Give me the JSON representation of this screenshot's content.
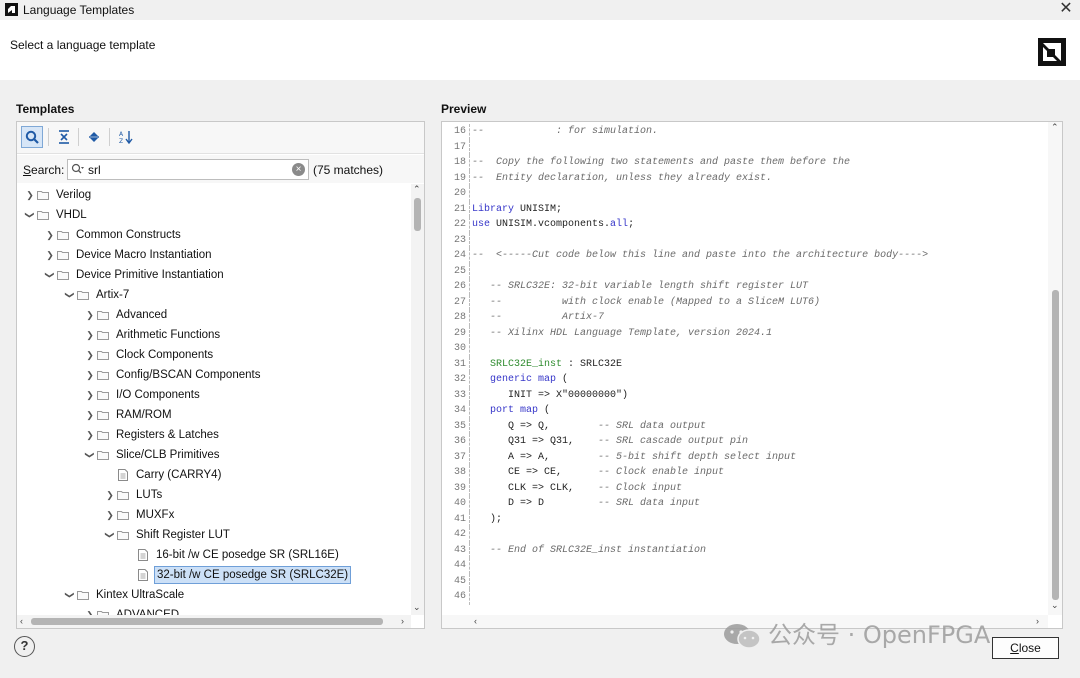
{
  "window": {
    "title": "Language Templates",
    "close_glyph": "✕"
  },
  "header": {
    "subtitle": "Select a language template"
  },
  "templates": {
    "label": "Templates",
    "search": {
      "label_mnemonic": "S",
      "label_rest": "earch:",
      "value": "srl",
      "placeholder": "",
      "matches": "(75 matches)"
    },
    "tree": [
      {
        "label": "Verilog",
        "depth": 0,
        "state": "collapsed",
        "type": "folder"
      },
      {
        "label": "VHDL",
        "depth": 0,
        "state": "expanded",
        "type": "folder"
      },
      {
        "label": "Common Constructs",
        "depth": 1,
        "state": "collapsed",
        "type": "folder"
      },
      {
        "label": "Device Macro Instantiation",
        "depth": 1,
        "state": "collapsed",
        "type": "folder"
      },
      {
        "label": "Device Primitive Instantiation",
        "depth": 1,
        "state": "expanded",
        "type": "folder"
      },
      {
        "label": "Artix-7",
        "depth": 2,
        "state": "expanded",
        "type": "folder"
      },
      {
        "label": "Advanced",
        "depth": 3,
        "state": "collapsed",
        "type": "folder"
      },
      {
        "label": "Arithmetic Functions",
        "depth": 3,
        "state": "collapsed",
        "type": "folder"
      },
      {
        "label": "Clock Components",
        "depth": 3,
        "state": "collapsed",
        "type": "folder"
      },
      {
        "label": "Config/BSCAN Components",
        "depth": 3,
        "state": "collapsed",
        "type": "folder"
      },
      {
        "label": "I/O Components",
        "depth": 3,
        "state": "collapsed",
        "type": "folder"
      },
      {
        "label": "RAM/ROM",
        "depth": 3,
        "state": "collapsed",
        "type": "folder"
      },
      {
        "label": "Registers & Latches",
        "depth": 3,
        "state": "collapsed",
        "type": "folder"
      },
      {
        "label": "Slice/CLB Primitives",
        "depth": 3,
        "state": "expanded",
        "type": "folder"
      },
      {
        "label": "Carry (CARRY4)",
        "depth": 4,
        "state": "leaf",
        "type": "file"
      },
      {
        "label": "LUTs",
        "depth": 4,
        "state": "collapsed",
        "type": "folder"
      },
      {
        "label": "MUXFx",
        "depth": 4,
        "state": "collapsed",
        "type": "folder"
      },
      {
        "label": "Shift Register LUT",
        "depth": 4,
        "state": "expanded",
        "type": "folder"
      },
      {
        "label": "16-bit /w CE posedge SR (SRL16E)",
        "depth": 5,
        "state": "leaf",
        "type": "file"
      },
      {
        "label": "32-bit /w CE posedge SR (SRLC32E)",
        "depth": 5,
        "state": "leaf",
        "type": "file",
        "selected": true
      },
      {
        "label": "Kintex UltraScale",
        "depth": 2,
        "state": "expanded",
        "type": "folder"
      },
      {
        "label": "ADVANCED",
        "depth": 3,
        "state": "collapsed",
        "type": "folder"
      }
    ]
  },
  "preview": {
    "label": "Preview",
    "lines": [
      {
        "n": "16",
        "segs": [
          [
            "cm",
            "--            : for simulation."
          ]
        ]
      },
      {
        "n": "17",
        "segs": []
      },
      {
        "n": "18",
        "segs": [
          [
            "cm",
            "--  Copy the following two statements and paste them before the"
          ]
        ]
      },
      {
        "n": "19",
        "segs": [
          [
            "cm",
            "--  Entity declaration, unless they already exist."
          ]
        ]
      },
      {
        "n": "20",
        "segs": []
      },
      {
        "n": "21",
        "segs": [
          [
            "kw",
            "Library"
          ],
          [
            "tx",
            " UNISIM;"
          ]
        ]
      },
      {
        "n": "22",
        "segs": [
          [
            "kw",
            "use"
          ],
          [
            "tx",
            " UNISIM.vcomponents."
          ],
          [
            "kw",
            "all"
          ],
          [
            "tx",
            ";"
          ]
        ]
      },
      {
        "n": "23",
        "segs": []
      },
      {
        "n": "24",
        "segs": [
          [
            "cm",
            "--  <-----Cut code below this line and paste into the architecture body---->"
          ]
        ]
      },
      {
        "n": "25",
        "segs": []
      },
      {
        "n": "26",
        "segs": [
          [
            "cm",
            "   -- SRLC32E: 32-bit variable length shift register LUT"
          ]
        ]
      },
      {
        "n": "27",
        "segs": [
          [
            "cm",
            "   --          with clock enable (Mapped to a SliceM LUT6)"
          ]
        ]
      },
      {
        "n": "28",
        "segs": [
          [
            "cm",
            "   --          Artix-7"
          ]
        ]
      },
      {
        "n": "29",
        "segs": [
          [
            "cm",
            "   -- Xilinx HDL Language Template, version 2024.1"
          ]
        ]
      },
      {
        "n": "30",
        "segs": []
      },
      {
        "n": "31",
        "segs": [
          [
            "tx",
            "   "
          ],
          [
            "inst",
            "SRLC32E_inst"
          ],
          [
            "tx",
            " : SRLC32E"
          ]
        ]
      },
      {
        "n": "32",
        "segs": [
          [
            "tx",
            "   "
          ],
          [
            "kw",
            "generic map"
          ],
          [
            "tx",
            " ("
          ]
        ]
      },
      {
        "n": "33",
        "segs": [
          [
            "tx",
            "      INIT => X\"00000000\")"
          ]
        ]
      },
      {
        "n": "34",
        "segs": [
          [
            "tx",
            "   "
          ],
          [
            "kw",
            "port map"
          ],
          [
            "tx",
            " ("
          ]
        ]
      },
      {
        "n": "35",
        "segs": [
          [
            "tx",
            "      Q => Q,        "
          ],
          [
            "cm",
            "-- SRL data output"
          ]
        ]
      },
      {
        "n": "36",
        "segs": [
          [
            "tx",
            "      Q31 => Q31,    "
          ],
          [
            "cm",
            "-- SRL cascade output pin"
          ]
        ]
      },
      {
        "n": "37",
        "segs": [
          [
            "tx",
            "      A => A,        "
          ],
          [
            "cm",
            "-- 5-bit shift depth select input"
          ]
        ]
      },
      {
        "n": "38",
        "segs": [
          [
            "tx",
            "      CE => CE,      "
          ],
          [
            "cm",
            "-- Clock enable input"
          ]
        ]
      },
      {
        "n": "39",
        "segs": [
          [
            "tx",
            "      CLK => CLK,    "
          ],
          [
            "cm",
            "-- Clock input"
          ]
        ]
      },
      {
        "n": "40",
        "segs": [
          [
            "tx",
            "      D => D         "
          ],
          [
            "cm",
            "-- SRL data input"
          ]
        ]
      },
      {
        "n": "41",
        "segs": [
          [
            "tx",
            "   );"
          ]
        ]
      },
      {
        "n": "42",
        "segs": []
      },
      {
        "n": "43",
        "segs": [
          [
            "cm",
            "   -- End of SRLC32E_inst instantiation"
          ]
        ]
      },
      {
        "n": "44",
        "segs": []
      },
      {
        "n": "45",
        "segs": []
      },
      {
        "n": "46",
        "segs": []
      }
    ]
  },
  "footer": {
    "help_glyph": "?",
    "close_mnemonic": "C",
    "close_rest": "lose"
  },
  "watermark": {
    "text": "公众号 · OpenFPGA"
  },
  "colors": {
    "keyword": "#3636c9",
    "comment": "#6a6a6a",
    "instance": "#2e8b2e",
    "selection": "#cce0f7"
  }
}
